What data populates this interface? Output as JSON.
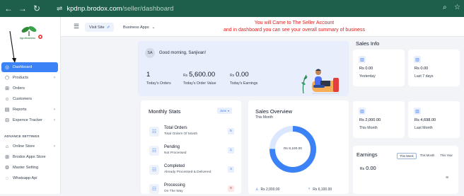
{
  "browser": {
    "back": "←",
    "forward": "→",
    "reload": "↻",
    "url_host": "kpdnp.brodox.com",
    "url_path": "/seller/dashboard"
  },
  "annotation": {
    "line1": "You will Came to The Seller Account",
    "line2": "and in dashboard you can see your overall summary of business",
    "color": "#e11d1d"
  },
  "logo": {
    "text": "AgroBusiness"
  },
  "sidebar": {
    "items": [
      {
        "label": "Dashboard",
        "icon": "dashboard-icon",
        "glyph": "◎"
      },
      {
        "label": "Products",
        "icon": "cube-icon",
        "glyph": "⬡"
      },
      {
        "label": "Orders",
        "icon": "cart-icon",
        "glyph": "⊞"
      },
      {
        "label": "Customers",
        "icon": "users-icon",
        "glyph": "☺"
      },
      {
        "label": "Reports",
        "icon": "chart-icon",
        "glyph": "▤"
      },
      {
        "label": "Expence Tracker",
        "icon": "wallet-icon",
        "glyph": "⊟"
      }
    ],
    "section": "ADVANCE SETTINGS",
    "advance": [
      {
        "label": "Online Store",
        "icon": "store-icon",
        "glyph": "⌂"
      },
      {
        "label": "Brodox Apps Store",
        "icon": "apps-icon",
        "glyph": "⊞"
      },
      {
        "label": "Master Setting",
        "icon": "gear-icon",
        "glyph": "⚙"
      },
      {
        "label": "Whatsapp Api",
        "icon": "whatsapp-icon",
        "glyph": "◌"
      }
    ]
  },
  "topbar": {
    "visit_site": "Visit Site",
    "business_apps": "Business Apps"
  },
  "welcome": {
    "avatar": "SA",
    "greeting": "Good morning, Sanjivan!",
    "stats": [
      {
        "currency": "",
        "value": "1",
        "label": "Today's Orders"
      },
      {
        "currency": "Rs",
        "value": "5,600.00",
        "label": "Today's Order Value"
      },
      {
        "currency": "Rs",
        "value": "0.00",
        "label": "Today's Earnings"
      }
    ]
  },
  "monthly": {
    "title": "Monthly Stats",
    "period": "June",
    "rows": [
      {
        "title": "Total Orders",
        "sub": "Total Orders Of Month",
        "count": "5"
      },
      {
        "title": "Pending",
        "sub": "Not Processed",
        "count": "1"
      },
      {
        "title": "Completed",
        "sub": "Already Processed & Delivered",
        "count": "3"
      },
      {
        "title": "Processing",
        "sub": "On The Way",
        "count": "0"
      }
    ]
  },
  "overview": {
    "title": "Sales Overview",
    "period": "This Month",
    "center": "Rs 8,100.00",
    "foot_left": "Rs 2,000.00",
    "foot_right": "Rs 6,100.00"
  },
  "sales_info": {
    "title": "Sales Info",
    "cards": [
      {
        "value": "Rs 0.00",
        "label": "Yesterday"
      },
      {
        "value": "Rs 0.00",
        "label": "Last 7 days"
      },
      {
        "value": "Rs 2,000.00",
        "label": "This Month"
      },
      {
        "value": "Rs 4,698.00",
        "label": "Last Month"
      }
    ]
  },
  "earnings": {
    "title": "Earnings",
    "tabs": [
      "This Week",
      "This Month",
      "This Year"
    ],
    "currency": "Rs",
    "value": "0.00"
  },
  "colors": {
    "browser_bar": "#1d5f4a",
    "accent": "#3b82f6",
    "welcome_bg": "#e8eefb"
  }
}
